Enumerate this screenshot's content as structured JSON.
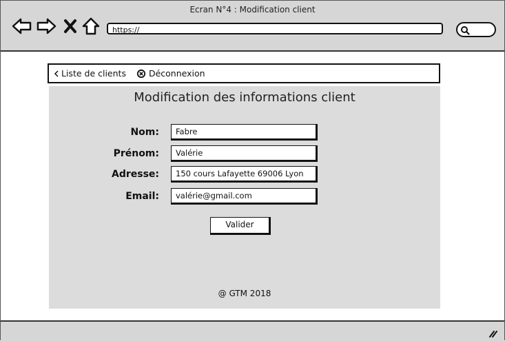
{
  "window": {
    "title": "Ecran N°4 : Modification client"
  },
  "browser": {
    "url": "https://"
  },
  "nav_links": {
    "back_label": "Liste de clients",
    "logout_label": "Déconnexion"
  },
  "form": {
    "title": "Modification des informations client",
    "fields": [
      {
        "label": "Nom:",
        "value": "Fabre"
      },
      {
        "label": "Prénom:",
        "value": "Valérie"
      },
      {
        "label": "Adresse:",
        "value": "150 cours Lafayette 69006 Lyon"
      },
      {
        "label": "Email:",
        "value": "valérie@gmail.com"
      }
    ],
    "submit_label": "Valider"
  },
  "footer": {
    "text": "@ GTM 2018"
  },
  "icons": {
    "back": "arrow-left-icon",
    "forward": "arrow-right-icon",
    "stop": "close-icon",
    "home": "home-icon",
    "search": "search-icon",
    "chevron": "chevron-left-icon",
    "logout": "close-circle-icon",
    "resize": "resize-grip-icon"
  }
}
